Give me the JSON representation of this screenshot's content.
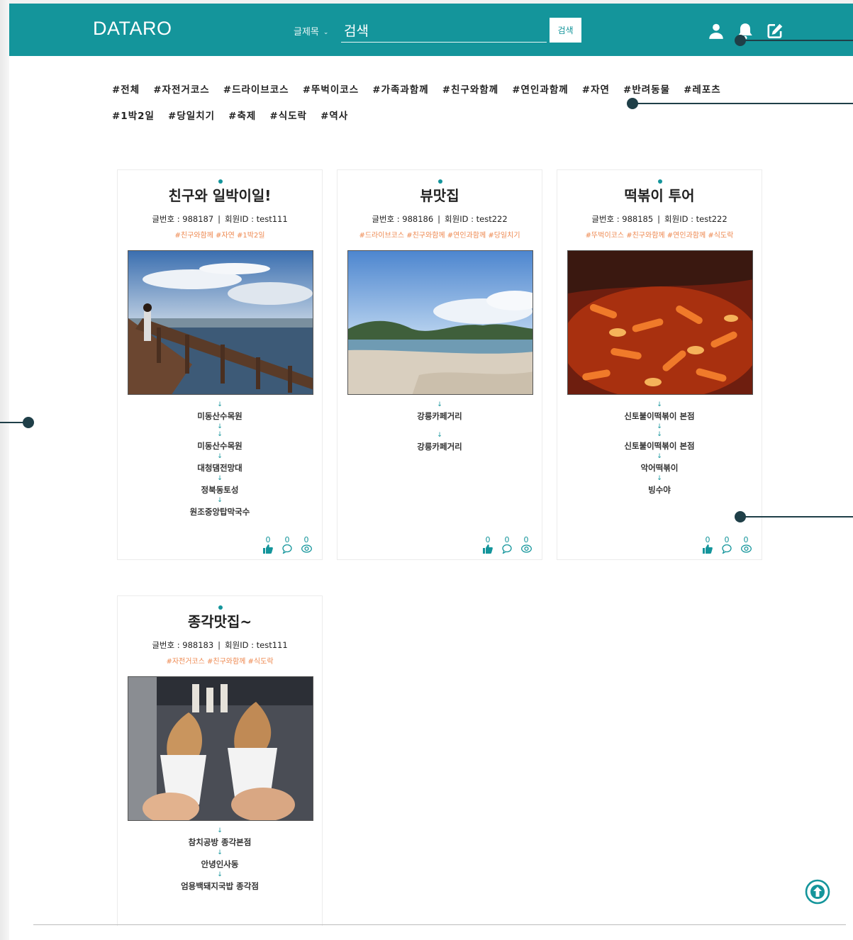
{
  "header": {
    "logo": "DATARO",
    "search_select": "글제목",
    "search_value": "검색",
    "search_button": "검색"
  },
  "tags": [
    "#전체",
    "#자전거코스",
    "#드라이브코스",
    "#뚜벅이코스",
    "#가족과함께",
    "#친구와함께",
    "#연인과함께",
    "#자연",
    "#반려동물",
    "#레포츠",
    "#1박2일",
    "#당일치기",
    "#축제",
    "#식도락",
    "#역사"
  ],
  "cards": [
    {
      "title": "친구와 일박이일!",
      "post_no_label": "글번호 : 988187",
      "member_label": "회원ID : test111",
      "tags": "#친구와함께 #자연 #1박2일",
      "route": [
        "미동산수목원",
        "미동산수목원",
        "대청댐전망대",
        "정북동토성",
        "원조중앙탑막국수"
      ],
      "likes": "0",
      "comments": "0",
      "views": "0",
      "image": "boardwalk-lake-photo"
    },
    {
      "title": "뷰맛집",
      "post_no_label": "글번호 : 988186",
      "member_label": "회원ID : test222",
      "tags": "#드라이브코스 #친구와함께 #연인과함께 #당일치기",
      "route": [
        "강릉카페거리",
        "강릉카페거리"
      ],
      "likes": "0",
      "comments": "0",
      "views": "0",
      "image": "beach-mountain-photo"
    },
    {
      "title": "떡볶이 투어",
      "post_no_label": "글번호 : 988185",
      "member_label": "회원ID : test222",
      "tags": "#뚜벅이코스 #친구와함께 #연인과함께 #식도락",
      "route": [
        "신토불이떡볶이 본점",
        "신토불이떡볶이 본점",
        "악어떡볶이",
        "빙수야"
      ],
      "likes": "0",
      "comments": "0",
      "views": "0",
      "image": "tteokbokki-photo"
    },
    {
      "title": "종각맛집~",
      "post_no_label": "글번호 : 988183",
      "member_label": "회원ID : test111",
      "tags": "#자전거코스 #친구와함께 #식도락",
      "route": [
        "참치공방 종각본점",
        "안녕인사동",
        "엄용백돼지국밥 종각점"
      ],
      "image": "soft-serve-ice-cream-photo"
    }
  ],
  "colors": {
    "primary": "#14959b",
    "tag_orange": "#ee8a52",
    "callout": "#1f3f48"
  },
  "icons": [
    "user-icon",
    "bell-icon",
    "edit-icon",
    "thumbs-up-icon",
    "comment-icon",
    "eye-icon",
    "arrow-up-circle-icon"
  ]
}
